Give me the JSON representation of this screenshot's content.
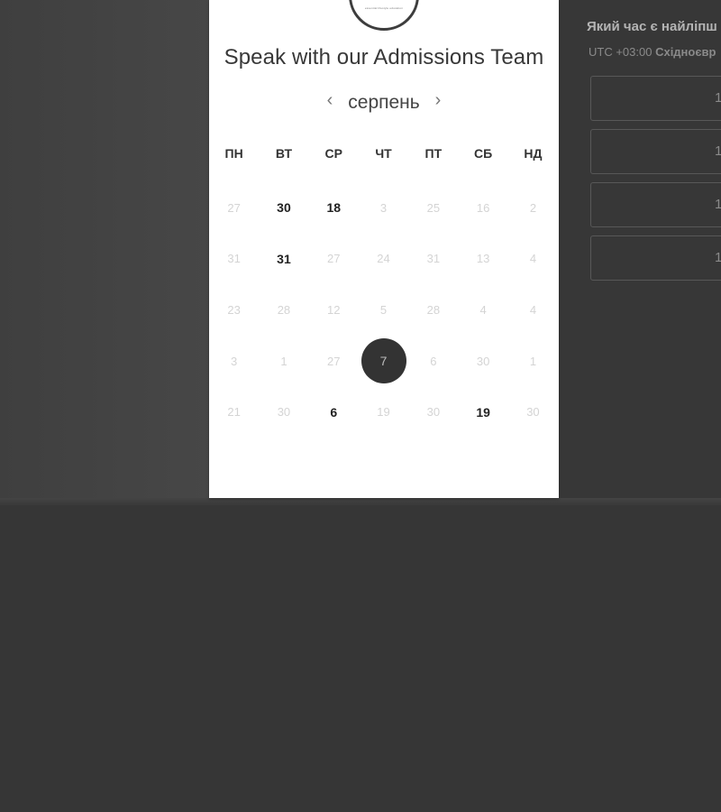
{
  "logo": {
    "tagline": "essential lifestyle education"
  },
  "calendar": {
    "title": "Speak with our Admissions Team",
    "month": "серпень",
    "prev_icon": "‹",
    "next_icon": "›",
    "weekdays": [
      "ПН",
      "ВТ",
      "СР",
      "ЧТ",
      "ПТ",
      "СБ",
      "НД"
    ],
    "weeks": [
      [
        {
          "d": "27",
          "available": false
        },
        {
          "d": "30",
          "available": true
        },
        {
          "d": "18",
          "available": true
        },
        {
          "d": "3",
          "available": false
        },
        {
          "d": "25",
          "available": false
        },
        {
          "d": "16",
          "available": false
        },
        {
          "d": "2",
          "available": false
        }
      ],
      [
        {
          "d": "31",
          "available": false
        },
        {
          "d": "31",
          "available": true
        },
        {
          "d": "27",
          "available": false
        },
        {
          "d": "24",
          "available": false
        },
        {
          "d": "31",
          "available": false
        },
        {
          "d": "13",
          "available": false
        },
        {
          "d": "4",
          "available": false
        }
      ],
      [
        {
          "d": "23",
          "available": false
        },
        {
          "d": "28",
          "available": false
        },
        {
          "d": "12",
          "available": false
        },
        {
          "d": "5",
          "available": false
        },
        {
          "d": "28",
          "available": false
        },
        {
          "d": "4",
          "available": false
        },
        {
          "d": "4",
          "available": false
        }
      ],
      [
        {
          "d": "3",
          "available": false
        },
        {
          "d": "1",
          "available": false
        },
        {
          "d": "27",
          "available": false
        },
        {
          "d": "7",
          "available": true,
          "selected": true
        },
        {
          "d": "6",
          "available": false
        },
        {
          "d": "30",
          "available": false
        },
        {
          "d": "1",
          "available": false
        }
      ],
      [
        {
          "d": "21",
          "available": false
        },
        {
          "d": "30",
          "available": false
        },
        {
          "d": "6",
          "available": true
        },
        {
          "d": "19",
          "available": false
        },
        {
          "d": "30",
          "available": false
        },
        {
          "d": "19",
          "available": true
        },
        {
          "d": "30",
          "available": false
        }
      ]
    ]
  },
  "right_panel": {
    "question": "Який час є найліпш",
    "timezone_offset": "UTC +03:00",
    "timezone_name": "Східноєвр",
    "slots": [
      "1",
      "1",
      "1",
      "1"
    ]
  },
  "colors": {
    "backdrop": "#363636",
    "card": "#ffffff",
    "selected_day": "#333333",
    "available_day_text": "#222222",
    "unavailable_day_text": "#d4d4d4"
  }
}
